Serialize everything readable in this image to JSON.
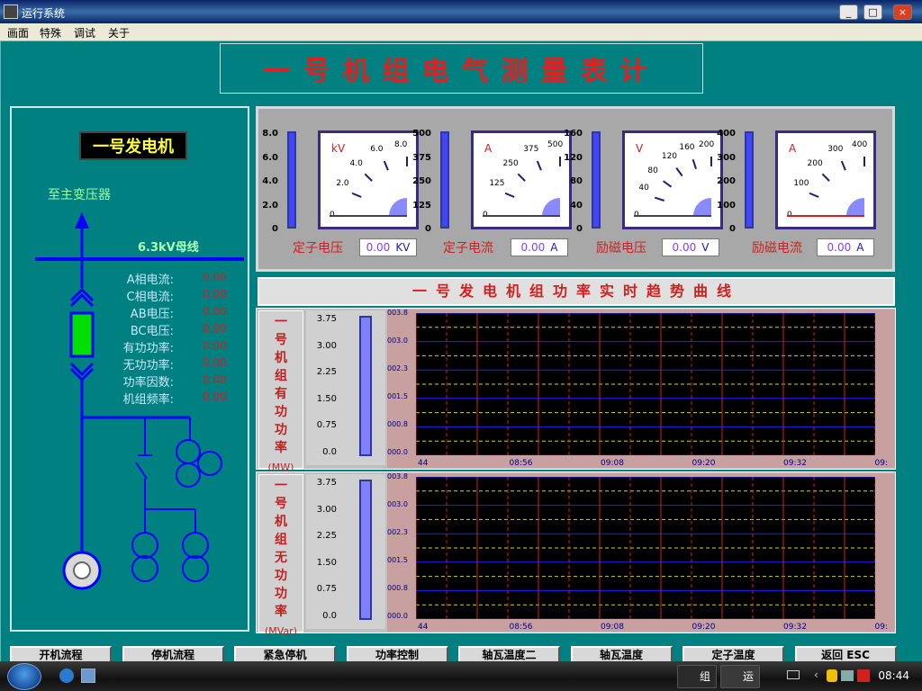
{
  "window": {
    "title": "运行系统",
    "min": "_",
    "max": "□",
    "close": "×"
  },
  "menu": [
    "画面",
    "特殊",
    "调试",
    "关于"
  ],
  "header": {
    "title": "一号机组电气测量表计"
  },
  "left": {
    "generator_label": "一号发电机",
    "to_transformer": "至主变压器",
    "bus_label": "6.3kV母线",
    "rows": [
      {
        "label": "A相电流:",
        "value": "0.00"
      },
      {
        "label": "C相电流:",
        "value": "0.00"
      },
      {
        "label": "AB电压:",
        "value": "0.00"
      },
      {
        "label": "BC电压:",
        "value": "0.00"
      },
      {
        "label": "有功功率:",
        "value": "0.00"
      },
      {
        "label": "无功功率:",
        "value": "0.00"
      },
      {
        "label": "功率因数:",
        "value": "0.00"
      },
      {
        "label": "机组频率:",
        "value": "0.00"
      }
    ]
  },
  "meters": [
    {
      "name": "定子电压",
      "unit": "kV",
      "unit_text": "KV",
      "value": "0.00",
      "scale": [
        "0",
        "2.0",
        "4.0",
        "6.0",
        "8.0"
      ],
      "bar_scale": [
        "8.0",
        "6.0",
        "4.0",
        "2.0",
        "0"
      ],
      "level": 0
    },
    {
      "name": "定子电流",
      "unit": "A",
      "unit_text": "A",
      "value": "0.00",
      "scale": [
        "0",
        "125",
        "250",
        "375",
        "500"
      ],
      "bar_scale": [
        "500",
        "375",
        "250",
        "125",
        "0"
      ],
      "level": 0
    },
    {
      "name": "励磁电压",
      "unit": "V",
      "unit_text": "V",
      "value": "0.00",
      "scale": [
        "0",
        "40",
        "80",
        "120",
        "160",
        "200"
      ],
      "bar_scale": [
        "160",
        "120",
        "80",
        "40",
        "0"
      ],
      "level": 0
    },
    {
      "name": "励磁电流",
      "unit": "A",
      "unit_text": "A",
      "value": "0.00",
      "scale": [
        "0",
        "100",
        "200",
        "300",
        "400"
      ],
      "bar_scale": [
        "400",
        "300",
        "200",
        "100",
        "0"
      ],
      "level": 0
    }
  ],
  "trend": {
    "title": "一号发电机组功率实时趋势曲线",
    "charts": [
      {
        "vtitle": [
          "一",
          "号",
          "机",
          "组",
          "有",
          "功",
          "功",
          "率"
        ],
        "unit": "(MW)",
        "yticks": [
          "3.75",
          "3.00",
          "2.25",
          "1.50",
          "0.75",
          "0.0"
        ],
        "plot_yticks": [
          "003.8",
          "003.0",
          "002.3",
          "001.5",
          "000.8",
          "000.0"
        ],
        "xticks": [
          "44",
          "08:56",
          "09:08",
          "09:20",
          "09:32",
          "09:"
        ]
      },
      {
        "vtitle": [
          "一",
          "号",
          "机",
          "组",
          "无",
          "功",
          "功",
          "率"
        ],
        "unit": "(MVar)",
        "yticks": [
          "3.75",
          "3.00",
          "2.25",
          "1.50",
          "0.75",
          "0.0"
        ],
        "plot_yticks": [
          "003.8",
          "003.0",
          "002.3",
          "001.5",
          "000.8",
          "000.0"
        ],
        "xticks": [
          "44",
          "08:56",
          "09:08",
          "09:20",
          "09:32",
          "09:"
        ]
      }
    ]
  },
  "buttons": [
    "开机流程",
    "停机流程",
    "紧急停机",
    "功率控制",
    "轴瓦温度二",
    "轴瓦温度",
    "定子温度",
    "返回 ESC"
  ],
  "taskbar": {
    "tasks": [
      "组",
      "运"
    ],
    "clock": "08:44"
  },
  "colors": {
    "background": "#008080",
    "title_red": "#e02020",
    "bus_blue": "#0000ff",
    "breaker_green": "#00e000"
  }
}
